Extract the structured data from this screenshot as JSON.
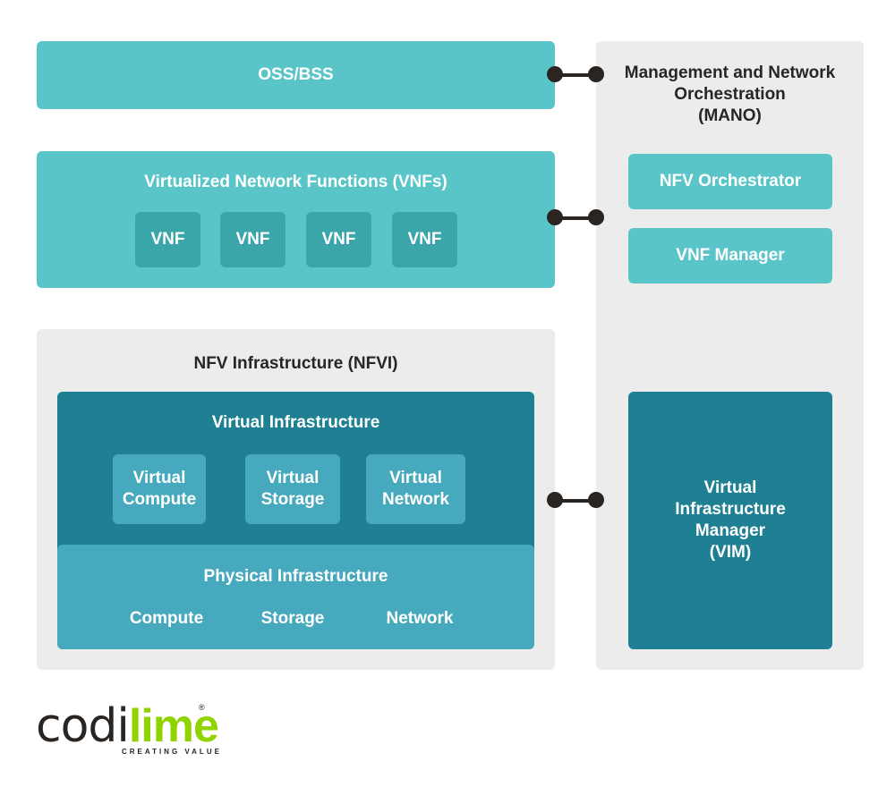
{
  "oss_bss": {
    "label": "OSS/BSS"
  },
  "vnfs": {
    "title": "Virtualized Network Functions (VNFs)",
    "items": [
      "VNF",
      "VNF",
      "VNF",
      "VNF"
    ]
  },
  "nfvi": {
    "title": "NFV Infrastructure (NFVI)",
    "virtual": {
      "title": "Virtual Infrastructure",
      "items": [
        {
          "line1": "Virtual",
          "line2": "Compute"
        },
        {
          "line1": "Virtual",
          "line2": "Storage"
        },
        {
          "line1": "Virtual",
          "line2": "Network"
        }
      ]
    },
    "physical": {
      "title": "Physical Infrastructure",
      "items": [
        "Compute",
        "Storage",
        "Network"
      ]
    }
  },
  "mano": {
    "title_line1": "Management and Network",
    "title_line2": "Orchestration",
    "title_line3": "(MANO)",
    "orchestrator": "NFV Orchestrator",
    "vnf_manager": "VNF Manager",
    "vim": {
      "line1": "Virtual",
      "line2": "Infrastructure",
      "line3": "Manager",
      "line4": "(VIM)"
    }
  },
  "logo": {
    "part1": "codi",
    "part2": "lime",
    "tagline": "CREATING VALUE",
    "registered": "®"
  },
  "colors": {
    "light_teal": "#5ac5c9",
    "mid_teal": "#3ba6aa",
    "dark_teal": "#1f8094",
    "physical_teal": "#46a9bd",
    "grey_panel": "#ececec",
    "connector": "#2b2522",
    "lime": "#8fd400"
  }
}
